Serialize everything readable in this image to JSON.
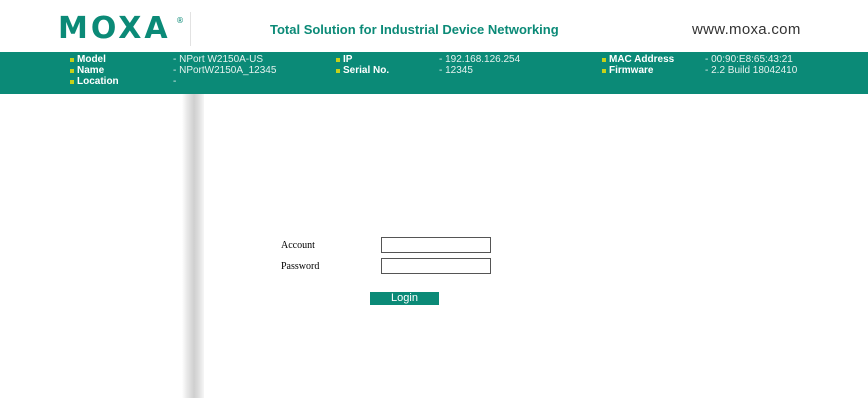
{
  "header": {
    "logo_text": "MOXA",
    "logo_mark": "®",
    "tagline": "Total Solution for Industrial Device Networking",
    "website": "www.moxa.com"
  },
  "device_info": {
    "model_label": "Model",
    "model_value": "- NPort W2150A-US",
    "name_label": "Name",
    "name_value": "- NPortW2150A_12345",
    "location_label": "Location",
    "location_value": "-",
    "ip_label": "IP",
    "ip_value": "- 192.168.126.254",
    "serial_label": "Serial No.",
    "serial_value": "- 12345",
    "mac_label": "MAC Address",
    "mac_value": "- 00:90:E8:65:43:21",
    "firmware_label": "Firmware",
    "firmware_value": "- 2.2 Build 18042410"
  },
  "login_form": {
    "account_label": "Account",
    "account_value": "",
    "password_label": "Password",
    "password_value": "",
    "login_button": "Login"
  },
  "colors": {
    "brand_green": "#0b8a77",
    "bullet": "#c6d11a"
  }
}
